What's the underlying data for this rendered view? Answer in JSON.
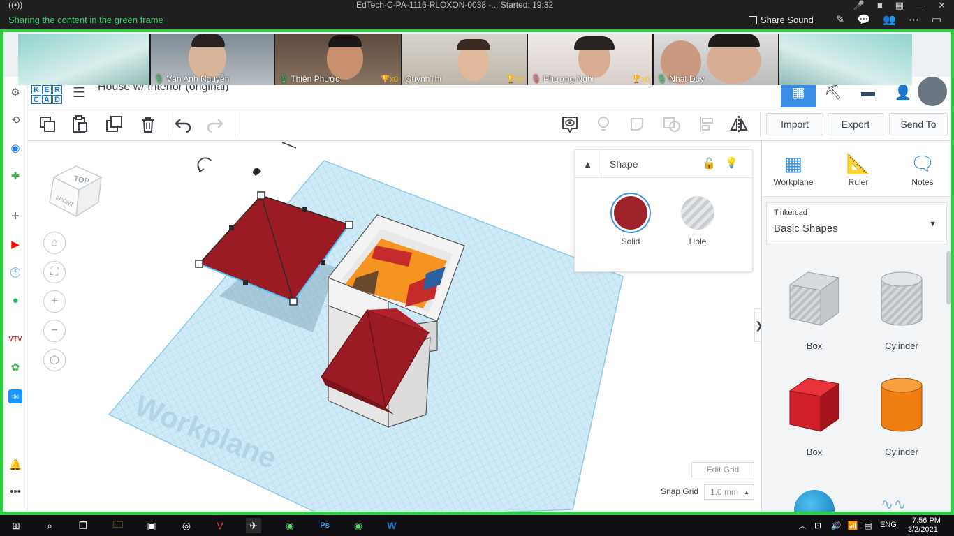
{
  "zoom": {
    "meeting_title": "EdTech-C-PA-1116-RLOXON-0038 -...    Started: 19:32",
    "sharing_notice": "Sharing the content in the green frame",
    "share_sound_label": "Share Sound",
    "participants": [
      {
        "name": "Văn Anh Nguyễn",
        "trophy": ""
      },
      {
        "name": "Thiên Phước",
        "trophy": "x0"
      },
      {
        "name": "QuynhThi",
        "trophy": "x0"
      },
      {
        "name": "Phương Nghi",
        "trophy": "x0"
      },
      {
        "name": "Nhat Duy",
        "trophy": "x0"
      }
    ]
  },
  "tinkercad": {
    "logo_letters": [
      "K",
      "E",
      "R",
      "C",
      "A",
      "D"
    ],
    "design_title": "House w/ Interior (original)",
    "toolbar": {
      "import_label": "Import",
      "export_label": "Export",
      "send_to_label": "Send To"
    },
    "nav_cube": {
      "top_label": "TOP",
      "front_label": "FRONT"
    },
    "workplane_watermark": "Workplane",
    "shape_panel": {
      "title": "Shape",
      "solid_label": "Solid",
      "hole_label": "Hole",
      "solid_color": "#9b1b24"
    },
    "grid": {
      "edit_grid_label": "Edit Grid",
      "snap_grid_label": "Snap Grid",
      "snap_grid_value": "1.0 mm"
    },
    "right_panel": {
      "tools": [
        {
          "label": "Workplane",
          "icon": "workplane-icon"
        },
        {
          "label": "Ruler",
          "icon": "ruler-icon"
        },
        {
          "label": "Notes",
          "icon": "notes-icon"
        }
      ],
      "library_source": "Tinkercad",
      "library_name": "Basic Shapes",
      "shapes": [
        {
          "label": "Box",
          "style": "hole"
        },
        {
          "label": "Cylinder",
          "style": "hole"
        },
        {
          "label": "Box",
          "style": "solid-red"
        },
        {
          "label": "Cylinder",
          "style": "solid-orange"
        }
      ]
    }
  },
  "taskbar": {
    "language": "ENG",
    "time": "7:56 PM",
    "date": "3/2/2021"
  },
  "colors": {
    "accent": "#3a8ee6",
    "frame_green": "#2ecc40",
    "roof_red": "#9b1b24",
    "grid_blue": "#a9d9ef"
  }
}
